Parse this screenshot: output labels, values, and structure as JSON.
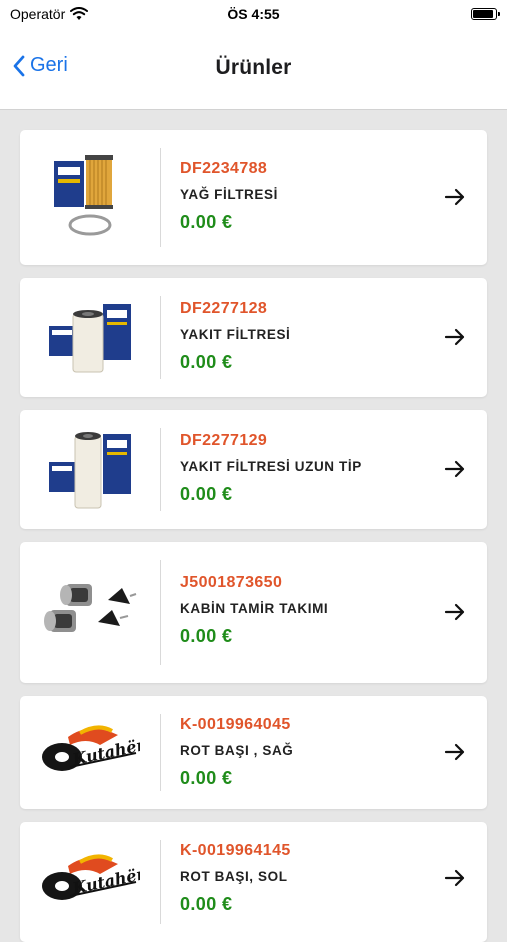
{
  "status_bar": {
    "carrier": "Operatör",
    "time": "ÖS 4:55",
    "battery_level": 0.9
  },
  "nav": {
    "back_label": "Geri",
    "title": "Ürünler"
  },
  "products": [
    {
      "code": "DF2234788",
      "name": "YAĞ FİLTRESİ",
      "price": "0.00 €",
      "image": "oil-filter-box"
    },
    {
      "code": "DF2277128",
      "name": "YAKIT FİLTRESİ",
      "price": "0.00 €",
      "image": "fuel-filter-box"
    },
    {
      "code": "DF2277129",
      "name": "YAKIT FİLTRESİ UZUN TİP",
      "price": "0.00 €",
      "image": "fuel-filter-long-box"
    },
    {
      "code": "J5001873650",
      "name": "KABİN TAMİR TAKIMI",
      "price": "0.00 €",
      "image": "cabin-mount-kit"
    },
    {
      "code": "K-0019964045",
      "name": "ROT BAŞI , SAĞ",
      "price": "0.00 €",
      "image": "kutaher-logo"
    },
    {
      "code": "K-0019964145",
      "name": "ROT BAŞI, SOL",
      "price": "0.00 €",
      "image": "kutaher-logo"
    }
  ],
  "colors": {
    "code": "#e0552b",
    "price": "#1f8c1a",
    "back": "#1a73e8",
    "background": "#e6e6e6"
  },
  "logo_text": "Kutahër"
}
